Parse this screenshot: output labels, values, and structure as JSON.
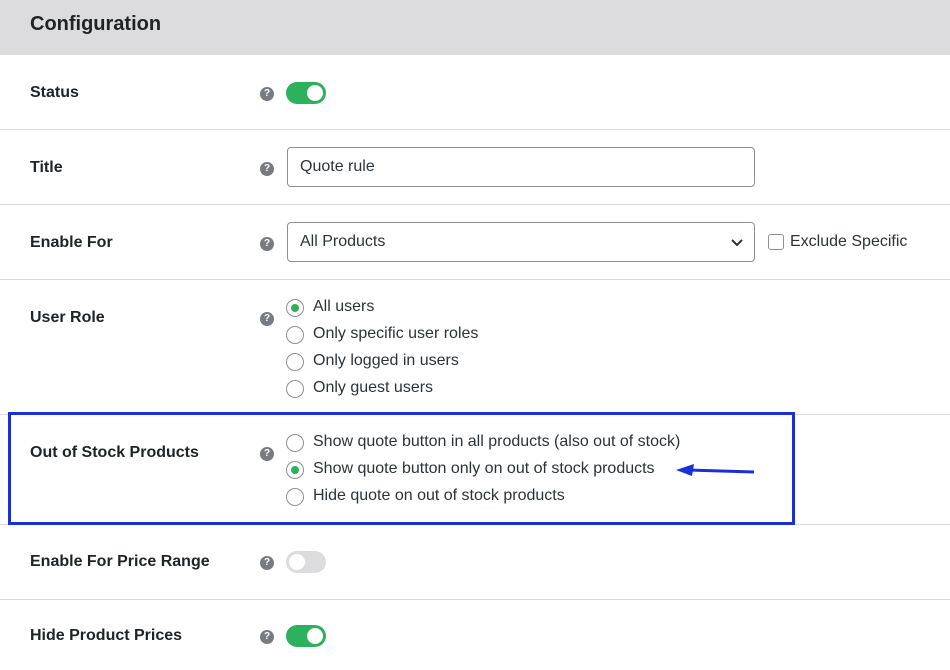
{
  "header": {
    "title": "Configuration"
  },
  "help_symbol": "?",
  "rows": {
    "status": {
      "label": "Status",
      "toggle_on": true
    },
    "title": {
      "label": "Title",
      "value": "Quote rule"
    },
    "enable_for": {
      "label": "Enable For",
      "selected": "All Products",
      "exclude_label": "Exclude Specific",
      "exclude_checked": false
    },
    "user_role": {
      "label": "User Role",
      "options": [
        {
          "label": "All users",
          "checked": true
        },
        {
          "label": "Only specific user roles",
          "checked": false
        },
        {
          "label": "Only logged in users",
          "checked": false
        },
        {
          "label": "Only guest users",
          "checked": false
        }
      ]
    },
    "out_of_stock": {
      "label": "Out of Stock Products",
      "options": [
        {
          "label": "Show quote button in all products (also out of stock)",
          "checked": false
        },
        {
          "label": "Show quote button only on out of stock products",
          "checked": true
        },
        {
          "label": "Hide quote on out of stock products",
          "checked": false
        }
      ]
    },
    "price_range": {
      "label": "Enable For Price Range",
      "toggle_on": false
    },
    "hide_prices": {
      "label": "Hide Product Prices",
      "toggle_on": true
    }
  },
  "colors": {
    "toggle_on": "#2eb15d",
    "highlight": "#1b2fd6",
    "header_bg": "#dcdcde"
  }
}
